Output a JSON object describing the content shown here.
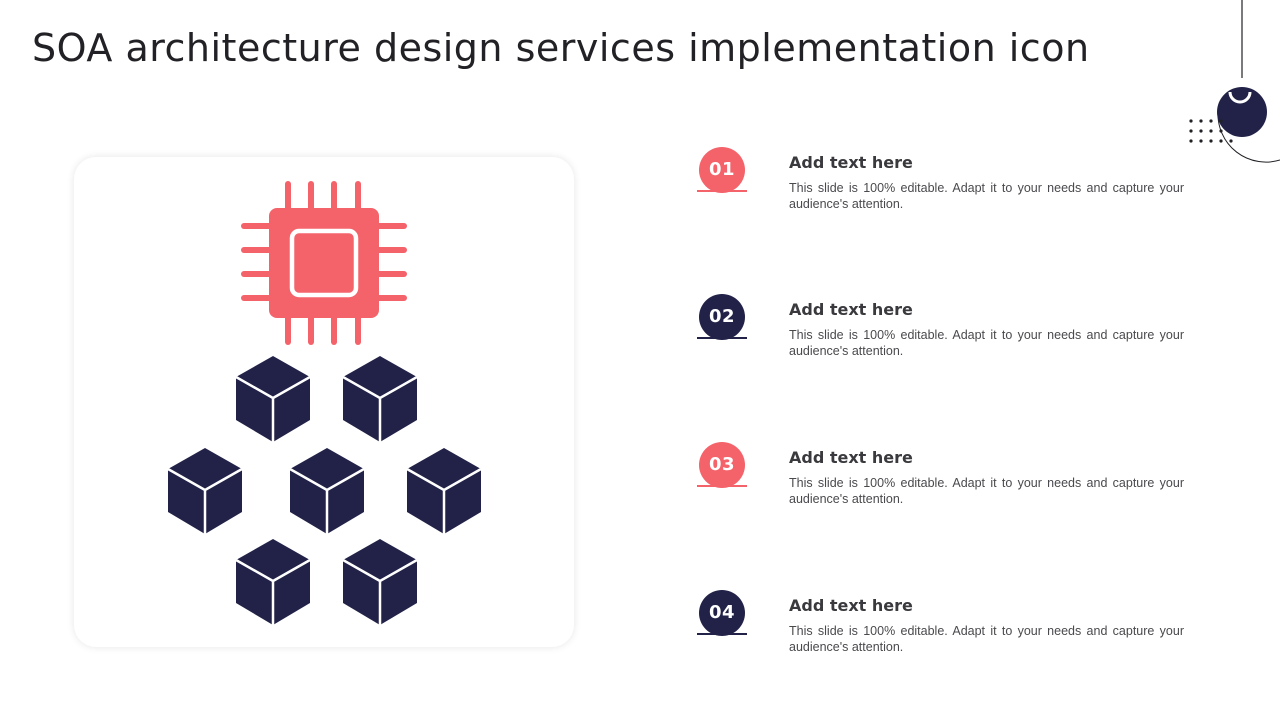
{
  "slide": {
    "title": "SOA architecture design services implementation icon"
  },
  "colors": {
    "coral": "#f4626a",
    "navy": "#222248",
    "title_text": "#222226",
    "body_text": "#4a4a4e"
  },
  "icon": {
    "chip_icon": "microchip-icon",
    "cube_icon": "cube-icon",
    "cube_count": 7
  },
  "items": [
    {
      "number": "01",
      "color": "#f4626a",
      "heading": "Add text here",
      "body": "This slide is 100% editable. Adapt it to your needs and capture your audience's attention."
    },
    {
      "number": "02",
      "color": "#222248",
      "heading": "Add text here",
      "body": "This slide is 100% editable. Adapt it to your needs and capture your audience's attention."
    },
    {
      "number": "03",
      "color": "#f4626a",
      "heading": "Add text here",
      "body": "This slide is 100% editable. Adapt it to your needs and capture your audience's attention."
    },
    {
      "number": "04",
      "color": "#222248",
      "heading": "Add text here",
      "body": "This slide is 100% editable. Adapt it to your needs and capture your audience's attention."
    }
  ]
}
